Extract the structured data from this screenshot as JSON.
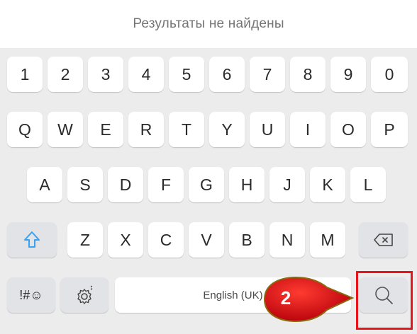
{
  "search": {
    "no_results_text": "Результаты не найдены"
  },
  "keyboard": {
    "number_row": [
      "1",
      "2",
      "3",
      "4",
      "5",
      "6",
      "7",
      "8",
      "9",
      "0"
    ],
    "row_q": [
      "Q",
      "W",
      "E",
      "R",
      "T",
      "Y",
      "U",
      "I",
      "O",
      "P"
    ],
    "row_a": [
      "A",
      "S",
      "D",
      "F",
      "G",
      "H",
      "J",
      "K",
      "L"
    ],
    "row_z": [
      "Z",
      "X",
      "C",
      "V",
      "B",
      "N",
      "M"
    ],
    "symbols_label": "!#☺",
    "space_label": "English (UK)",
    "icons": {
      "shift": "shift-arrow-icon",
      "backspace": "backspace-icon",
      "settings": "gear-icon",
      "search": "search-icon"
    }
  },
  "annotation": {
    "step_label": "2",
    "callout_color": "#e8141a",
    "highlight_color": "#e8141a"
  },
  "colors": {
    "keyboard_bg": "#ececed",
    "key_bg": "#ffffff",
    "func_key_bg": "#e2e3e6",
    "shift_arrow": "#3aa0f0"
  }
}
